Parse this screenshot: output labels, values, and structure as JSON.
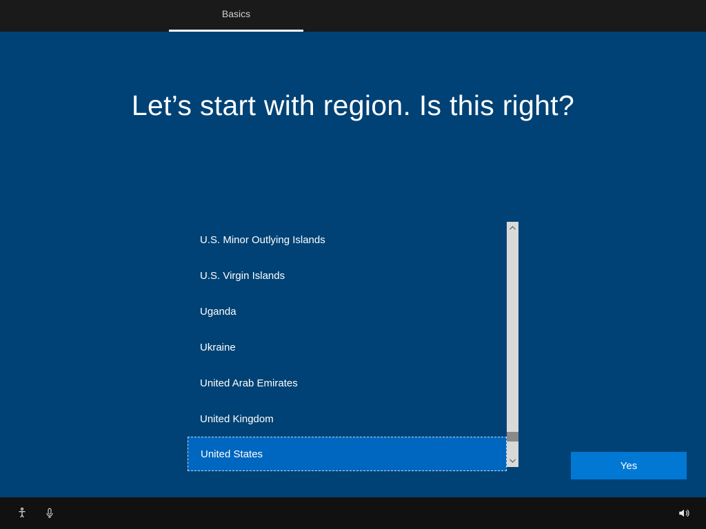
{
  "header": {
    "tab_label": "Basics"
  },
  "title": "Let’s start with region. Is this right?",
  "regions": {
    "items": [
      "U.S. Minor Outlying Islands",
      "U.S. Virgin Islands",
      "Uganda",
      "Ukraine",
      "United Arab Emirates",
      "United Kingdom",
      "United States"
    ],
    "selected_index": 6
  },
  "yes_label": "Yes"
}
